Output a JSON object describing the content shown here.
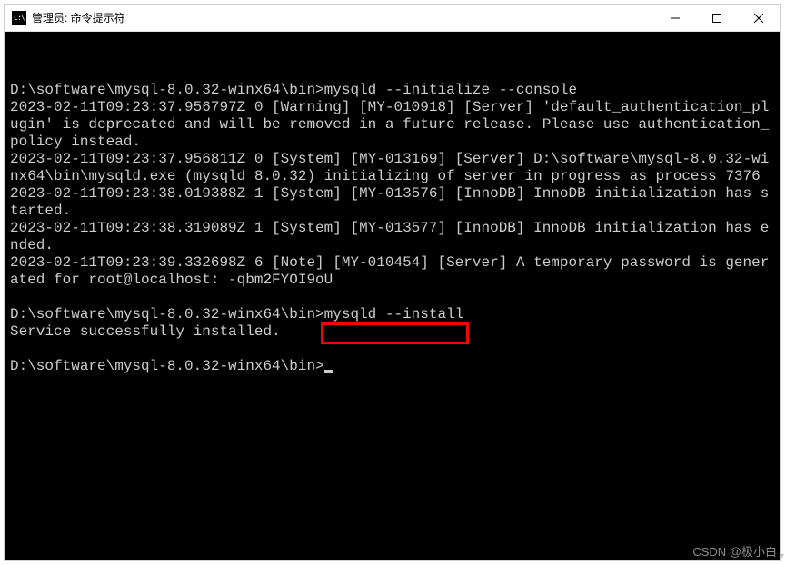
{
  "window": {
    "icon_text": "C:\\",
    "title": "管理员: 命令提示符"
  },
  "terminal": {
    "prompt1_path": "D:\\software\\mysql-8.0.32-winx64\\bin>",
    "prompt1_cmd": "mysqld --initialize --console",
    "line1": "2023-02-11T09:23:37.956797Z 0 [Warning] [MY-010918] [Server] 'default_authentication_plugin' is deprecated and will be removed in a future release. Please use authentication_policy instead.",
    "line2": "2023-02-11T09:23:37.956811Z 0 [System] [MY-013169] [Server] D:\\software\\mysql-8.0.32-winx64\\bin\\mysqld.exe (mysqld 8.0.32) initializing of server in progress as process 7376",
    "line3": "2023-02-11T09:23:38.019388Z 1 [System] [MY-013576] [InnoDB] InnoDB initialization has started.",
    "line4": "2023-02-11T09:23:38.319089Z 1 [System] [MY-013577] [InnoDB] InnoDB initialization has ended.",
    "line5": "2023-02-11T09:23:39.332698Z 6 [Note] [MY-010454] [Server] A temporary password is generated for root@localhost: -qbm2FYOI9oU",
    "prompt2_path": "D:\\software\\mysql-8.0.32-winx64\\bin>",
    "prompt2_cmd": "mysqld --install",
    "line6": "Service successfully installed.",
    "prompt3_path": "D:\\software\\mysql-8.0.32-winx64\\bin>"
  },
  "watermark": "CSDN @极小白"
}
